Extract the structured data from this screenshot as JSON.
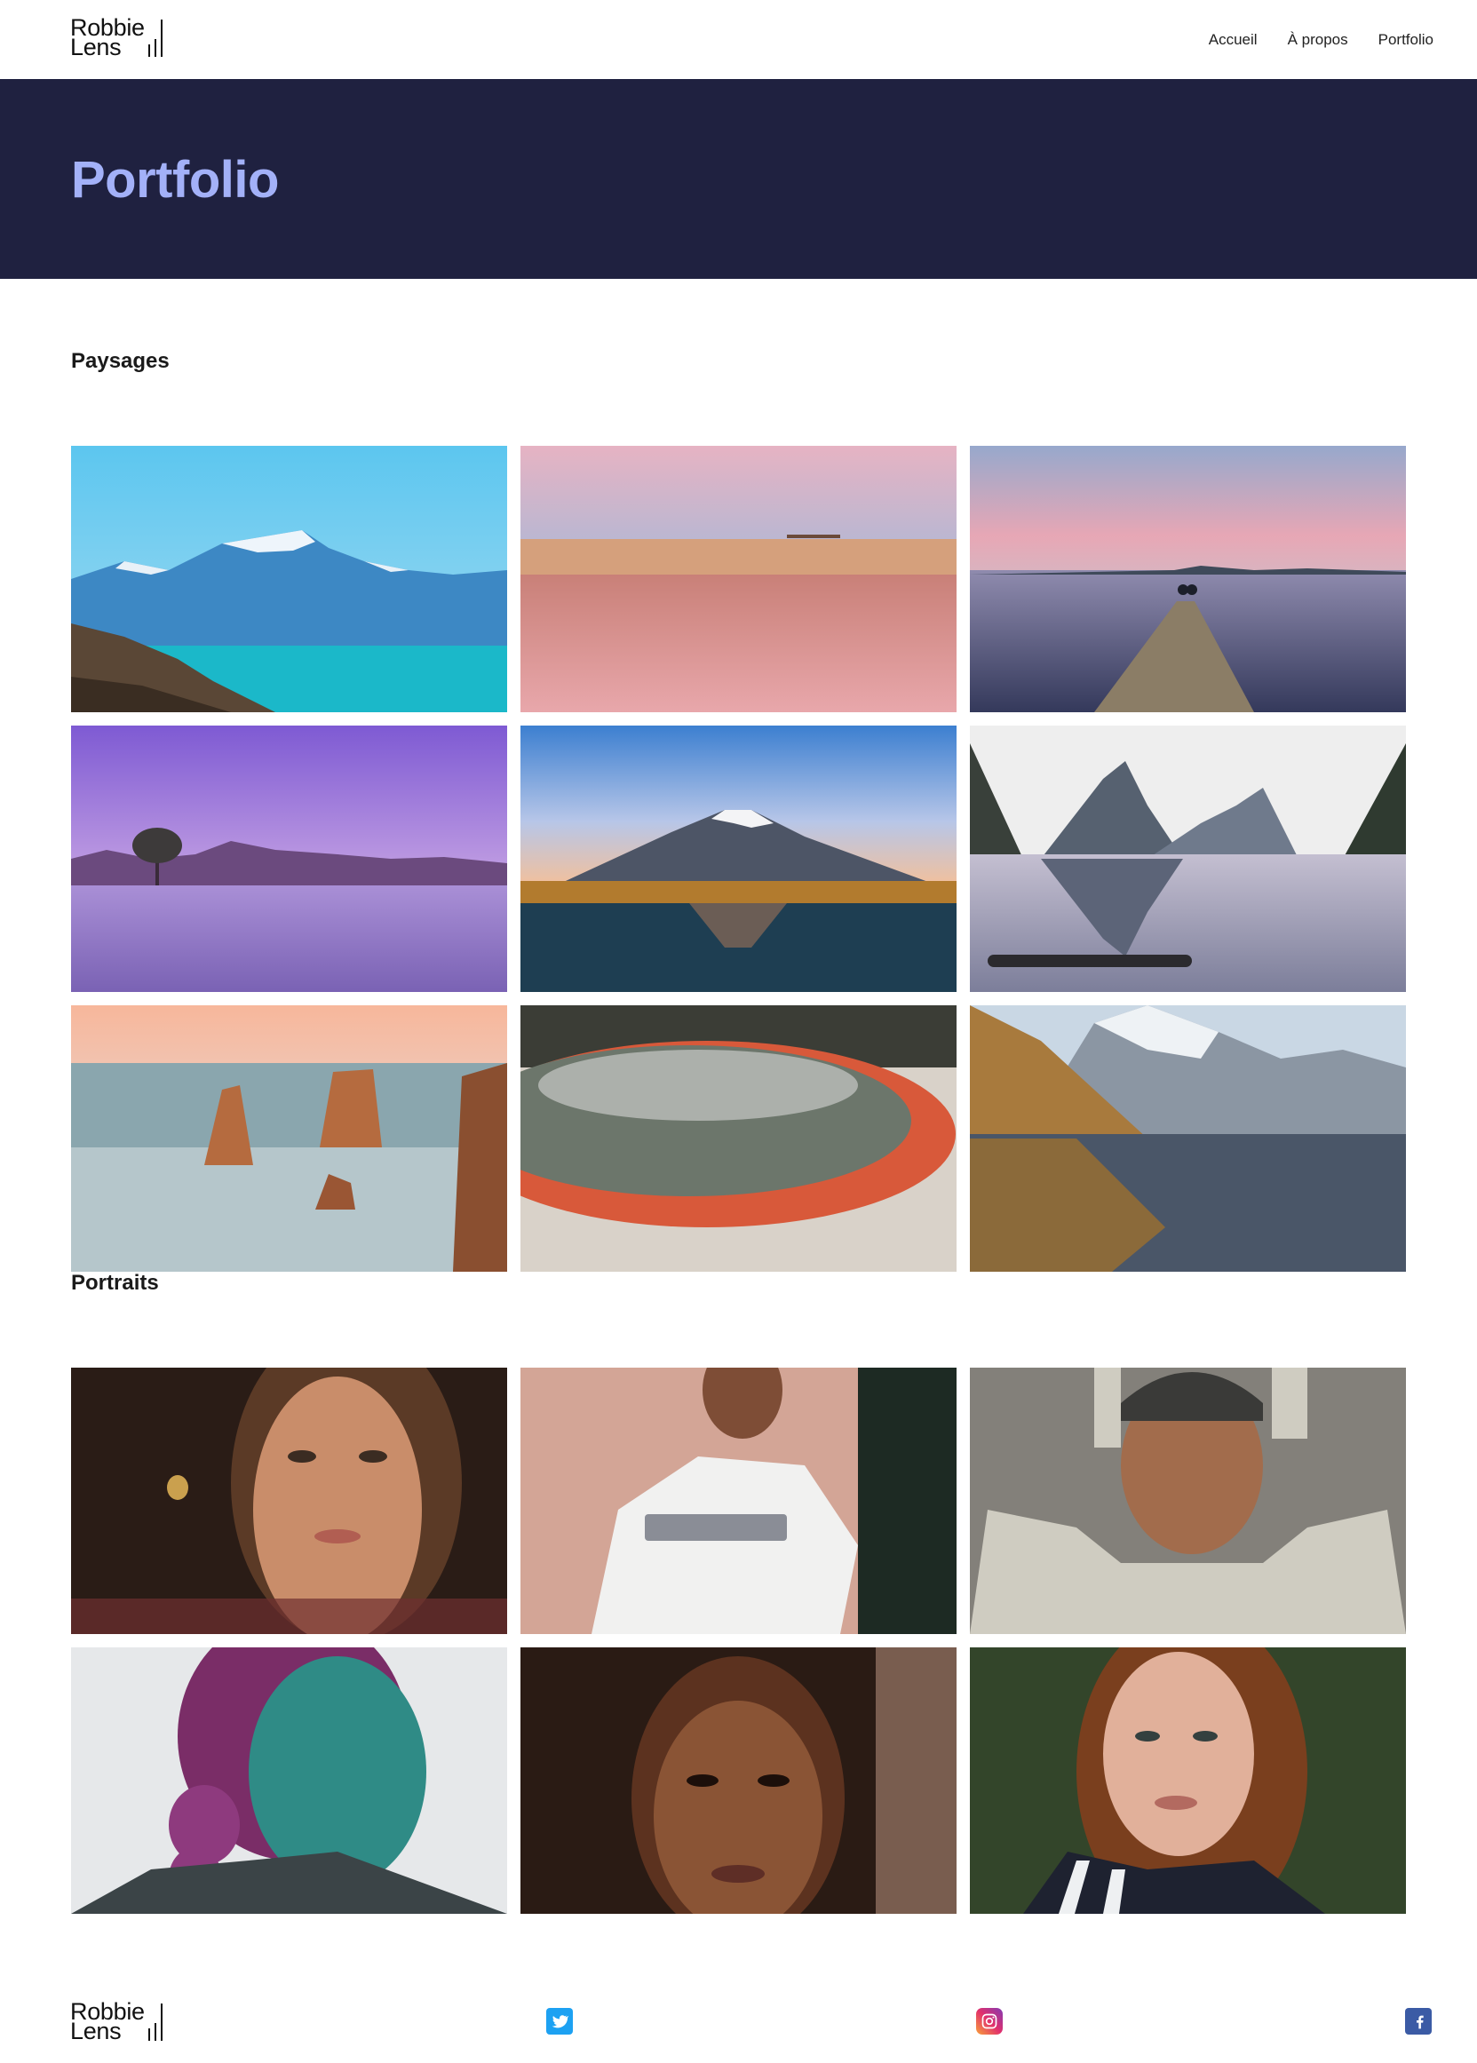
{
  "brand": {
    "line1": "Robbie",
    "line2": "Lens"
  },
  "nav": [
    {
      "label": "Accueil"
    },
    {
      "label": "À propos"
    },
    {
      "label": "Portfolio"
    }
  ],
  "hero": {
    "title": "Portfolio"
  },
  "sections": {
    "landscapes": {
      "title": "Paysages"
    },
    "portraits": {
      "title": "Portraits"
    }
  },
  "colors": {
    "hero_bg": "#1f2140",
    "hero_title": "#a3b1f8",
    "twitter": "#1da1f2",
    "facebook": "#3b5ba5"
  },
  "footer": {
    "social": [
      {
        "icon": "twitter-icon"
      },
      {
        "icon": "instagram-icon"
      },
      {
        "icon": "facebook-icon"
      }
    ]
  }
}
